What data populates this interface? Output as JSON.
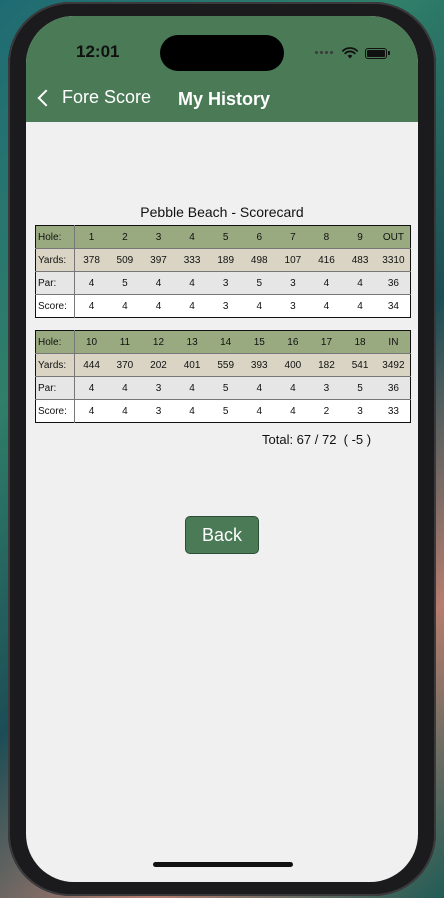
{
  "status": {
    "time": "12:01"
  },
  "nav": {
    "back_label": "Fore Score",
    "title": "My History"
  },
  "scorecard": {
    "title": "Pebble Beach - Scorecard",
    "front": {
      "hole_label": "Hole:",
      "holes": [
        "1",
        "2",
        "3",
        "4",
        "5",
        "6",
        "7",
        "8",
        "9",
        "OUT"
      ],
      "yards_label": "Yards:",
      "yards": [
        "378",
        "509",
        "397",
        "333",
        "189",
        "498",
        "107",
        "416",
        "483",
        "3310"
      ],
      "par_label": "Par:",
      "par": [
        "4",
        "5",
        "4",
        "4",
        "3",
        "5",
        "3",
        "4",
        "4",
        "36"
      ],
      "score_label": "Score:",
      "score": [
        "4",
        "4",
        "4",
        "4",
        "3",
        "4",
        "3",
        "4",
        "4",
        "34"
      ]
    },
    "back": {
      "hole_label": "Hole:",
      "holes": [
        "10",
        "11",
        "12",
        "13",
        "14",
        "15",
        "16",
        "17",
        "18",
        "IN"
      ],
      "yards_label": "Yards:",
      "yards": [
        "444",
        "370",
        "202",
        "401",
        "559",
        "393",
        "400",
        "182",
        "541",
        "3492"
      ],
      "par_label": "Par:",
      "par": [
        "4",
        "4",
        "3",
        "4",
        "5",
        "4",
        "4",
        "3",
        "5",
        "36"
      ],
      "score_label": "Score:",
      "score": [
        "4",
        "4",
        "3",
        "4",
        "5",
        "4",
        "4",
        "2",
        "3",
        "33"
      ]
    },
    "total": "Total: 67 / 72  ( -5 )"
  },
  "actions": {
    "back_button": "Back"
  },
  "colors": {
    "header": "#4a7a56",
    "hole_row": "#9aaa80",
    "yards_row": "#d9d4c4",
    "par_row": "#e6e6e6",
    "score_row": "#ffffff"
  },
  "icons": {
    "back": "chevron-left-icon",
    "wifi": "wifi-icon",
    "battery": "battery-icon",
    "signal": "signal-icon"
  }
}
